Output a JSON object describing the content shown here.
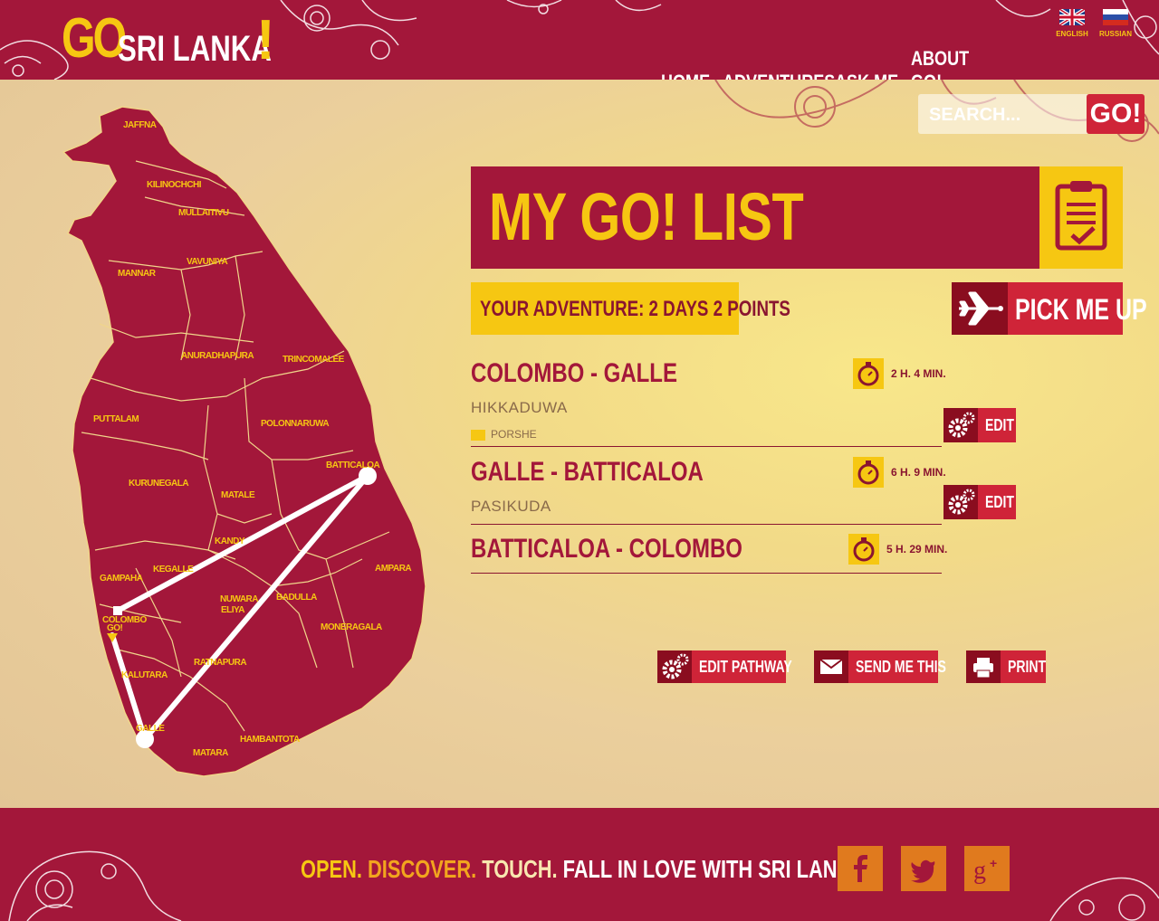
{
  "header": {
    "logo": {
      "go": "GO",
      "name": "SRI LANKA",
      "exclaim": "!"
    },
    "languages": [
      {
        "label": "ENGLISH"
      },
      {
        "label": "RUSSIAN"
      }
    ],
    "nav": [
      "HOME",
      "ADVENTURES",
      "ASK ME",
      "ABOUT GO!"
    ]
  },
  "search": {
    "placeholder": "SEARCH...",
    "button": "GO!"
  },
  "map": {
    "districts": [
      "JAFFNA",
      "KILINOCHCHI",
      "MULLAITIVU",
      "MANNAR",
      "VAVUNIYA",
      "ANURADHAPURA",
      "TRINCOMALEE",
      "PUTTALAM",
      "POLONNARUWA",
      "BATTICALOA",
      "KURUNEGALA",
      "MATALE",
      "KANDY",
      "KEGALLE",
      "GAMPAHA",
      "AMPARA",
      "NUWARA",
      "ELIYA",
      "BADULLA",
      "COLOMBO",
      "MONERAGALA",
      "KALUTARA",
      "RATNAPURA",
      "GALLE",
      "HAMBANTOTA",
      "MATARA"
    ],
    "start_marker": "GO!"
  },
  "list": {
    "title": "MY GO! LIST",
    "summary": "YOUR ADVENTURE: 2 DAYS 2 POINTS",
    "pickup": "PICK ME UP",
    "routes": [
      {
        "title": "COLOMBO - GALLE",
        "stop": "HIKKADUWA",
        "car": "PORSHE",
        "time": "2 H. 4 MIN.",
        "edit": "EDIT"
      },
      {
        "title": "GALLE - BATTICALOA",
        "stop": "PASIKUDA",
        "time": "6 H. 9 MIN.",
        "edit": "EDIT"
      },
      {
        "title": "BATTICALOA - COLOMBO",
        "time": "5 H. 29 MIN."
      }
    ],
    "actions": [
      "EDIT PATHWAY",
      "SEND ME THIS",
      "PRINT"
    ]
  },
  "footer": {
    "slogan": {
      "w1": "OPEN.",
      "w2": "DISCOVER.",
      "w3": "TOUCH.",
      "w4": "FALL IN LOVE WITH SRI LANKA"
    },
    "social": [
      "facebook-icon",
      "twitter-icon",
      "google-plus-icon"
    ]
  },
  "colors": {
    "brand": "#a3173a",
    "accent": "#f6c712",
    "button": "#cf2438",
    "dark": "#8a0d1f"
  }
}
